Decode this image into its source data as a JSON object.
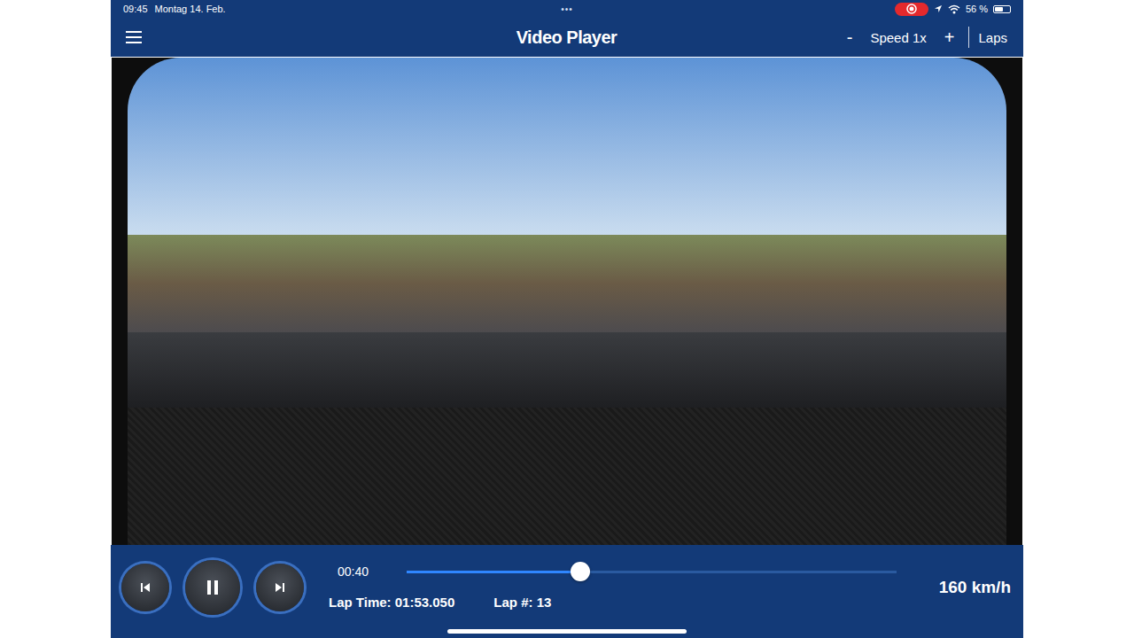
{
  "status_bar": {
    "time": "09:45",
    "date": "Montag 14. Feb.",
    "dots": "•••",
    "recording": true,
    "battery_text": "56 %",
    "battery_level": 0.56
  },
  "header": {
    "title": "Video Player",
    "speed_minus": "-",
    "speed_label": "Speed 1x",
    "speed_plus": "+",
    "laps": "Laps"
  },
  "controls": {
    "elapsed": "00:40",
    "level": 0.355,
    "lap_time": "Lap Time: 01:53.050",
    "lap_number": "Lap #: 13",
    "speed": "160 km/h",
    "playing": true
  }
}
